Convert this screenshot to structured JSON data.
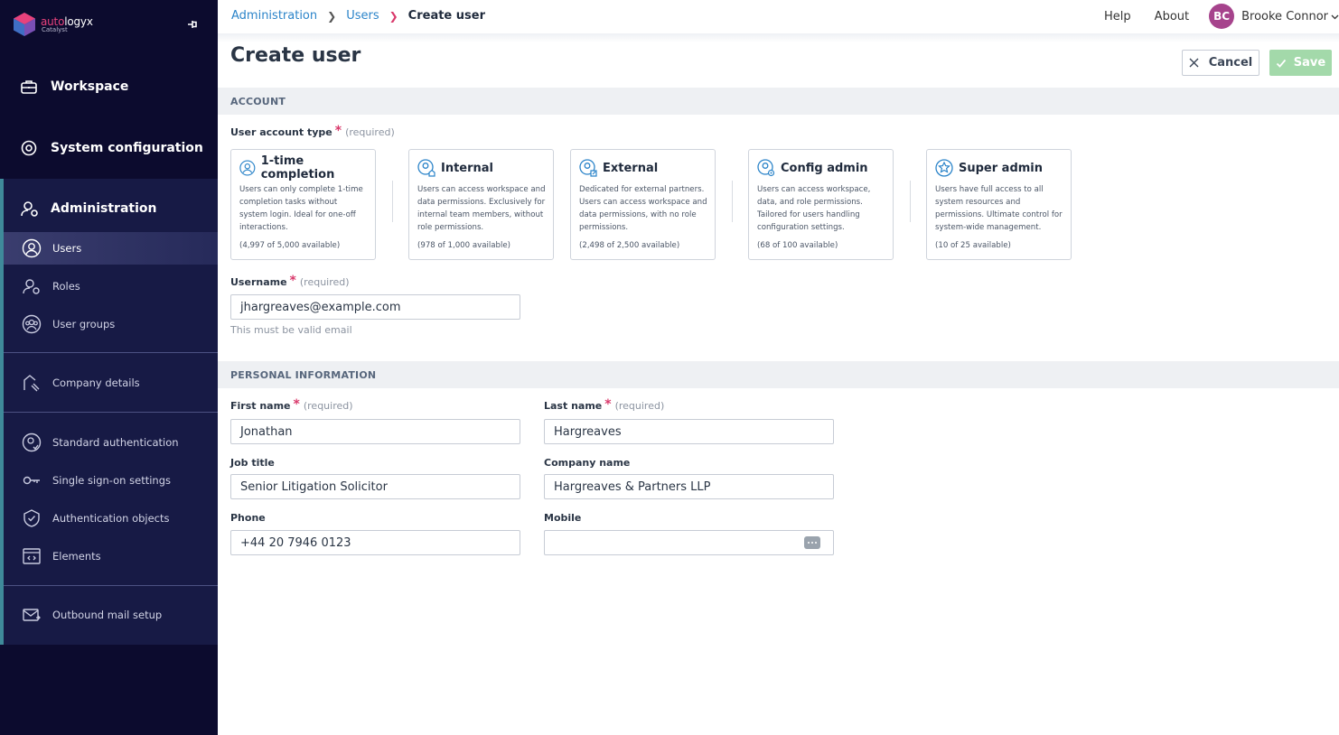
{
  "brand": {
    "name_part1": "auto",
    "name_part2": "logyx",
    "sub": "Catalyst"
  },
  "sidebar": {
    "workspace": "Workspace",
    "system_configuration": "System configuration",
    "administration": "Administration",
    "items": [
      {
        "label": "Users",
        "icon": "user-icon"
      },
      {
        "label": "Roles",
        "icon": "roles-icon"
      },
      {
        "label": "User groups",
        "icon": "user-groups-icon"
      },
      {
        "label": "Company details",
        "icon": "company-details-icon"
      },
      {
        "label": "Standard authentication",
        "icon": "standard-authentication-icon"
      },
      {
        "label": "Single sign-on settings",
        "icon": "key-icon"
      },
      {
        "label": "Authentication objects",
        "icon": "shield-icon"
      },
      {
        "label": "Elements",
        "icon": "elements-icon"
      },
      {
        "label": "Outbound mail setup",
        "icon": "mail-icon"
      }
    ]
  },
  "breadcrumb": {
    "items": [
      "Administration",
      "Users"
    ],
    "current": "Create user"
  },
  "header": {
    "help": "Help",
    "about": "About",
    "avatar_initials": "BC",
    "user_name": "Brooke Connor"
  },
  "page": {
    "title": "Create user",
    "cancel_label": "Cancel",
    "save_label": "Save"
  },
  "colors": {
    "sidebar_bg": "#0c0b2e",
    "accent_link": "#2b84c9",
    "required_star": "#d9396b",
    "save_disabled": "#a3d9aa",
    "avatar": "#a6438c"
  },
  "account": {
    "section_title": "ACCOUNT",
    "type_label": "User account type",
    "required_text": "(required)",
    "cards": [
      {
        "title": "1-time completion",
        "desc": "Users can only complete 1-time completion tasks without system login. Ideal for one-off interactions.",
        "avail": "(4,997 of 5,000 available)"
      },
      {
        "title": "Internal",
        "desc": "Users can access workspace and data permissions. Exclusively for internal team members, without role permissions.",
        "avail": "(978 of 1,000 available)"
      },
      {
        "title": "External",
        "desc": "Dedicated for external partners. Users can access workspace and data permissions, with no role permissions.",
        "avail": "(2,498 of 2,500 available)"
      },
      {
        "title": "Config admin",
        "desc": "Users can access workspace, data, and role permissions. Tailored for users handling configuration settings.",
        "avail": "(68 of 100 available)"
      },
      {
        "title": "Super admin",
        "desc": "Users have full access to all system resources and permissions. Ultimate control for system-wide management.",
        "avail": "(10 of 25 available)"
      }
    ],
    "username_label": "Username",
    "username_value": "jhargreaves@example.com",
    "username_hint": "This must be valid email"
  },
  "personal": {
    "section_title": "PERSONAL INFORMATION",
    "first_name_label": "First name",
    "first_name_value": "Jonathan",
    "last_name_label": "Last name",
    "last_name_value": "Hargreaves",
    "job_title_label": "Job title",
    "job_title_value": "Senior Litigation Solicitor",
    "company_name_label": "Company name",
    "company_name_value": "Hargreaves & Partners LLP",
    "phone_label": "Phone",
    "phone_value": "+44 20 7946 0123",
    "mobile_label": "Mobile",
    "mobile_value": ""
  }
}
